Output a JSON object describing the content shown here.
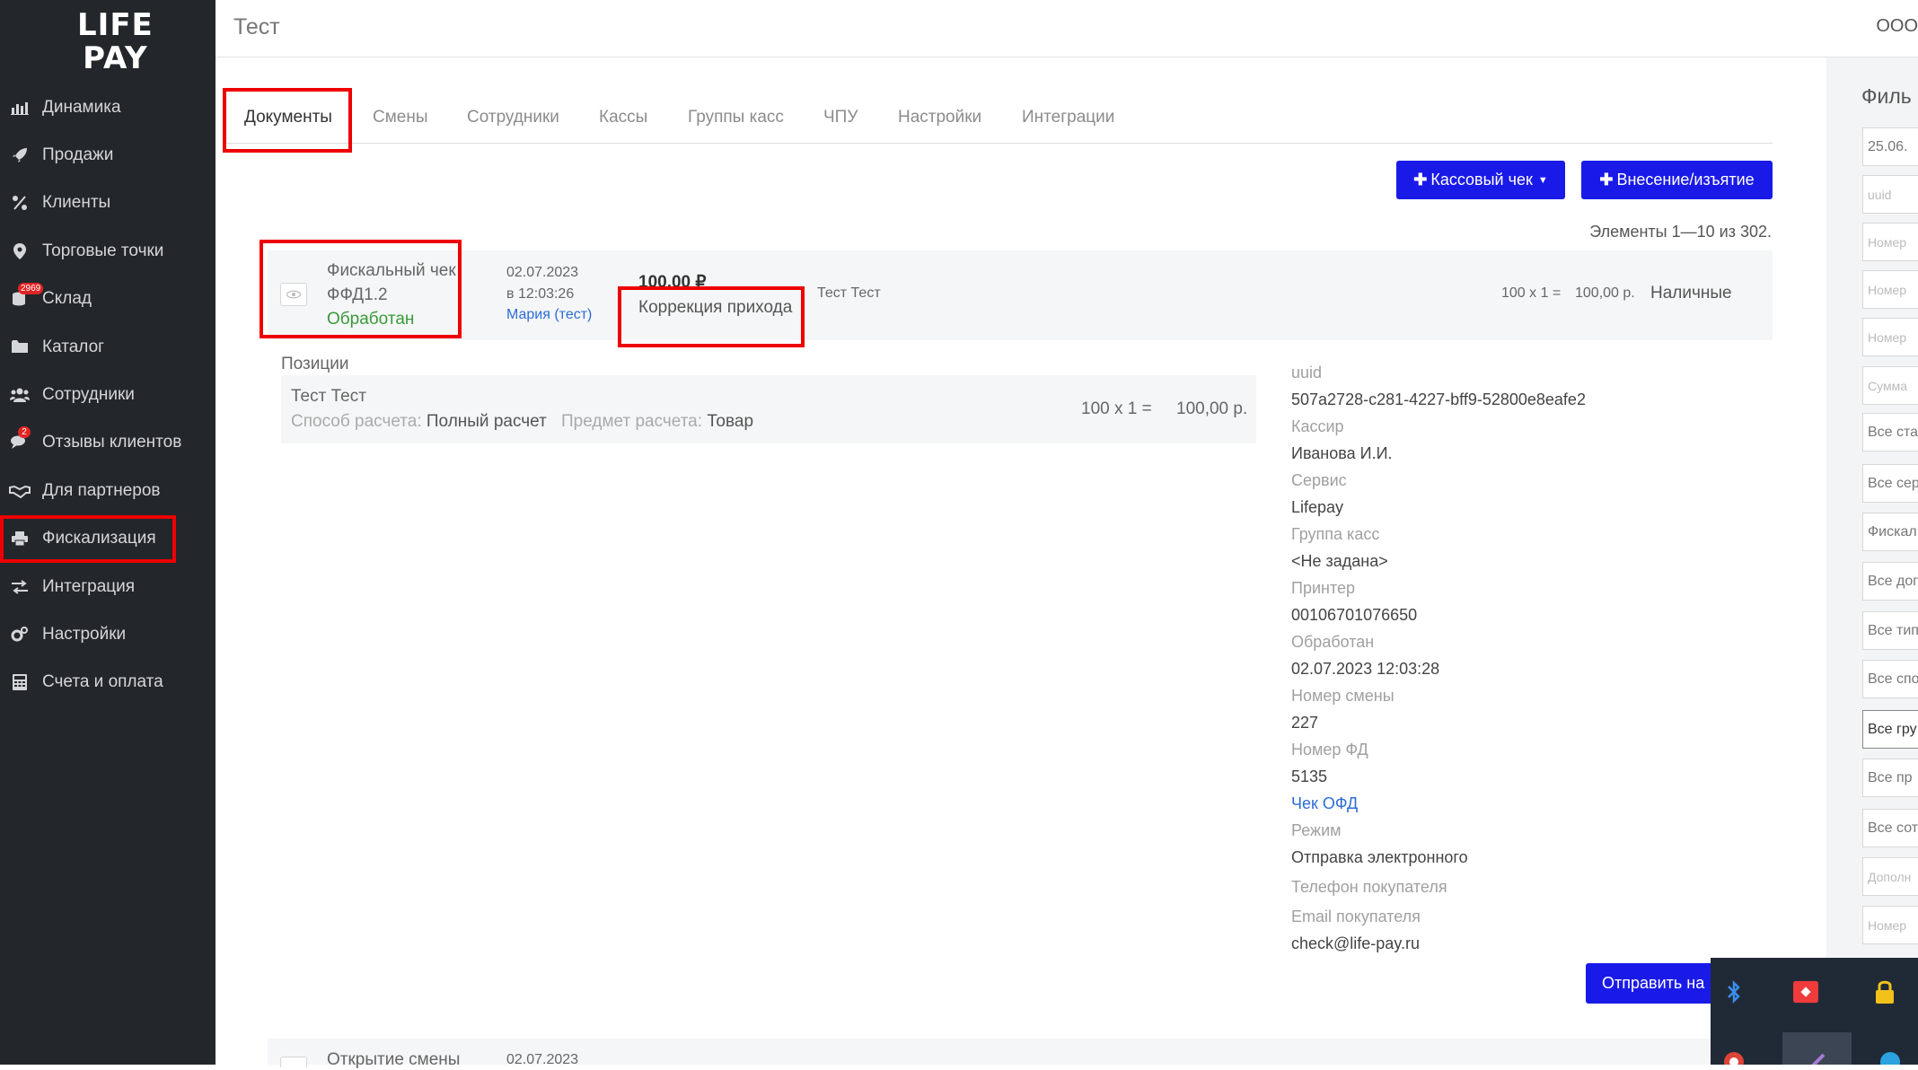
{
  "app": {
    "logo_line1": "LIFE",
    "logo_line2": "PAY"
  },
  "sidebar": {
    "items": [
      {
        "label": "Динамика",
        "icon": "bar-chart-icon"
      },
      {
        "label": "Продажи",
        "icon": "rocket-icon"
      },
      {
        "label": "Клиенты",
        "icon": "percent-icon"
      },
      {
        "label": "Торговые точки",
        "icon": "map-pin-icon"
      },
      {
        "label": "Склад",
        "icon": "coins-icon",
        "badge": "2969"
      },
      {
        "label": "Каталог",
        "icon": "folder-icon"
      },
      {
        "label": "Сотрудники",
        "icon": "users-icon"
      },
      {
        "label": "Отзывы клиентов",
        "icon": "comments-icon",
        "badge": "2"
      },
      {
        "label": "Для партнеров",
        "icon": "handshake-icon"
      },
      {
        "label": "Фискализация",
        "icon": "printer-icon",
        "active": true
      },
      {
        "label": "Интеграция",
        "icon": "exchange-icon"
      },
      {
        "label": "Настройки",
        "icon": "gears-icon"
      },
      {
        "label": "Счета и оплата",
        "icon": "calculator-icon"
      }
    ]
  },
  "header": {
    "title": "Тест",
    "right_text": "ООО"
  },
  "tabs": [
    "Документы",
    "Смены",
    "Сотрудники",
    "Кассы",
    "Группы касс",
    "ЧПУ",
    "Настройки",
    "Интеграции"
  ],
  "toolbar": {
    "receipt_button": "Кассовый чек",
    "deposit_button": "Внесение/изъятие",
    "count_text": "Элементы 1—10 из 302."
  },
  "document": {
    "type_line1": "Фискальный чек",
    "type_line2": "ФФД1.2",
    "status": "Обработан",
    "date": "02.07.2023",
    "time": "в 12:03:26",
    "cashier_link": "Мария (тест)",
    "amount": "100,00 ₽",
    "operation": "Коррекция прихода",
    "customer": "Тест Тест",
    "calc": "100 x 1 =",
    "calc_sum": "100,00 р.",
    "payment_type": "Наличные"
  },
  "positions": {
    "title": "Позиции",
    "item_name": "Тест Тест",
    "method_label": "Способ расчета:",
    "method_value": "Полный расчет",
    "subject_label": "Предмет расчета:",
    "subject_value": "Товар",
    "calc": "100 x 1 =",
    "sum": "100,00 р."
  },
  "details": {
    "uuid_label": "uuid",
    "uuid_value": "507a2728-c281-4227-bff9-52800e8eafe2",
    "cashier_label": "Кассир",
    "cashier_value": "Иванова И.И.",
    "service_label": "Сервис",
    "service_value": "Lifepay",
    "group_label": "Группа касс",
    "group_value": "<Не задана>",
    "printer_label": "Принтер",
    "printer_value": "00106701076650",
    "processed_label": "Обработан",
    "processed_value": "02.07.2023 12:03:28",
    "shift_label": "Номер смены",
    "shift_value": "227",
    "fd_label": "Номер ФД",
    "fd_value": "5135",
    "ofd_link": "Чек ОФД",
    "mode_label": "Режим",
    "mode_value": "Отправка электронного",
    "phone_label": "Телефон покупателя",
    "email_label": "Email покупателя",
    "email_value": "check@life-pay.ru",
    "send_button": "Отправить на"
  },
  "next_row": {
    "type": "Открытие смены",
    "date": "02.07.2023"
  },
  "filter": {
    "title": "Филь",
    "inputs": [
      "25.06.",
      "uuid",
      "Номер",
      "Номер",
      "Номер",
      "Сумма",
      "Все ста",
      "Все сер",
      "Фискал",
      "Все доп",
      "Все тип",
      "Все спо",
      "Все гру",
      "Все пр",
      "Все сот",
      "Дополн",
      "Номер"
    ]
  },
  "colors": {
    "sidebar_bg": "#23272b",
    "accent_blue": "#1a1ae8",
    "status_green": "#3a9a3a",
    "link_blue": "#2d6bd6",
    "highlight_red": "#ee0000"
  }
}
